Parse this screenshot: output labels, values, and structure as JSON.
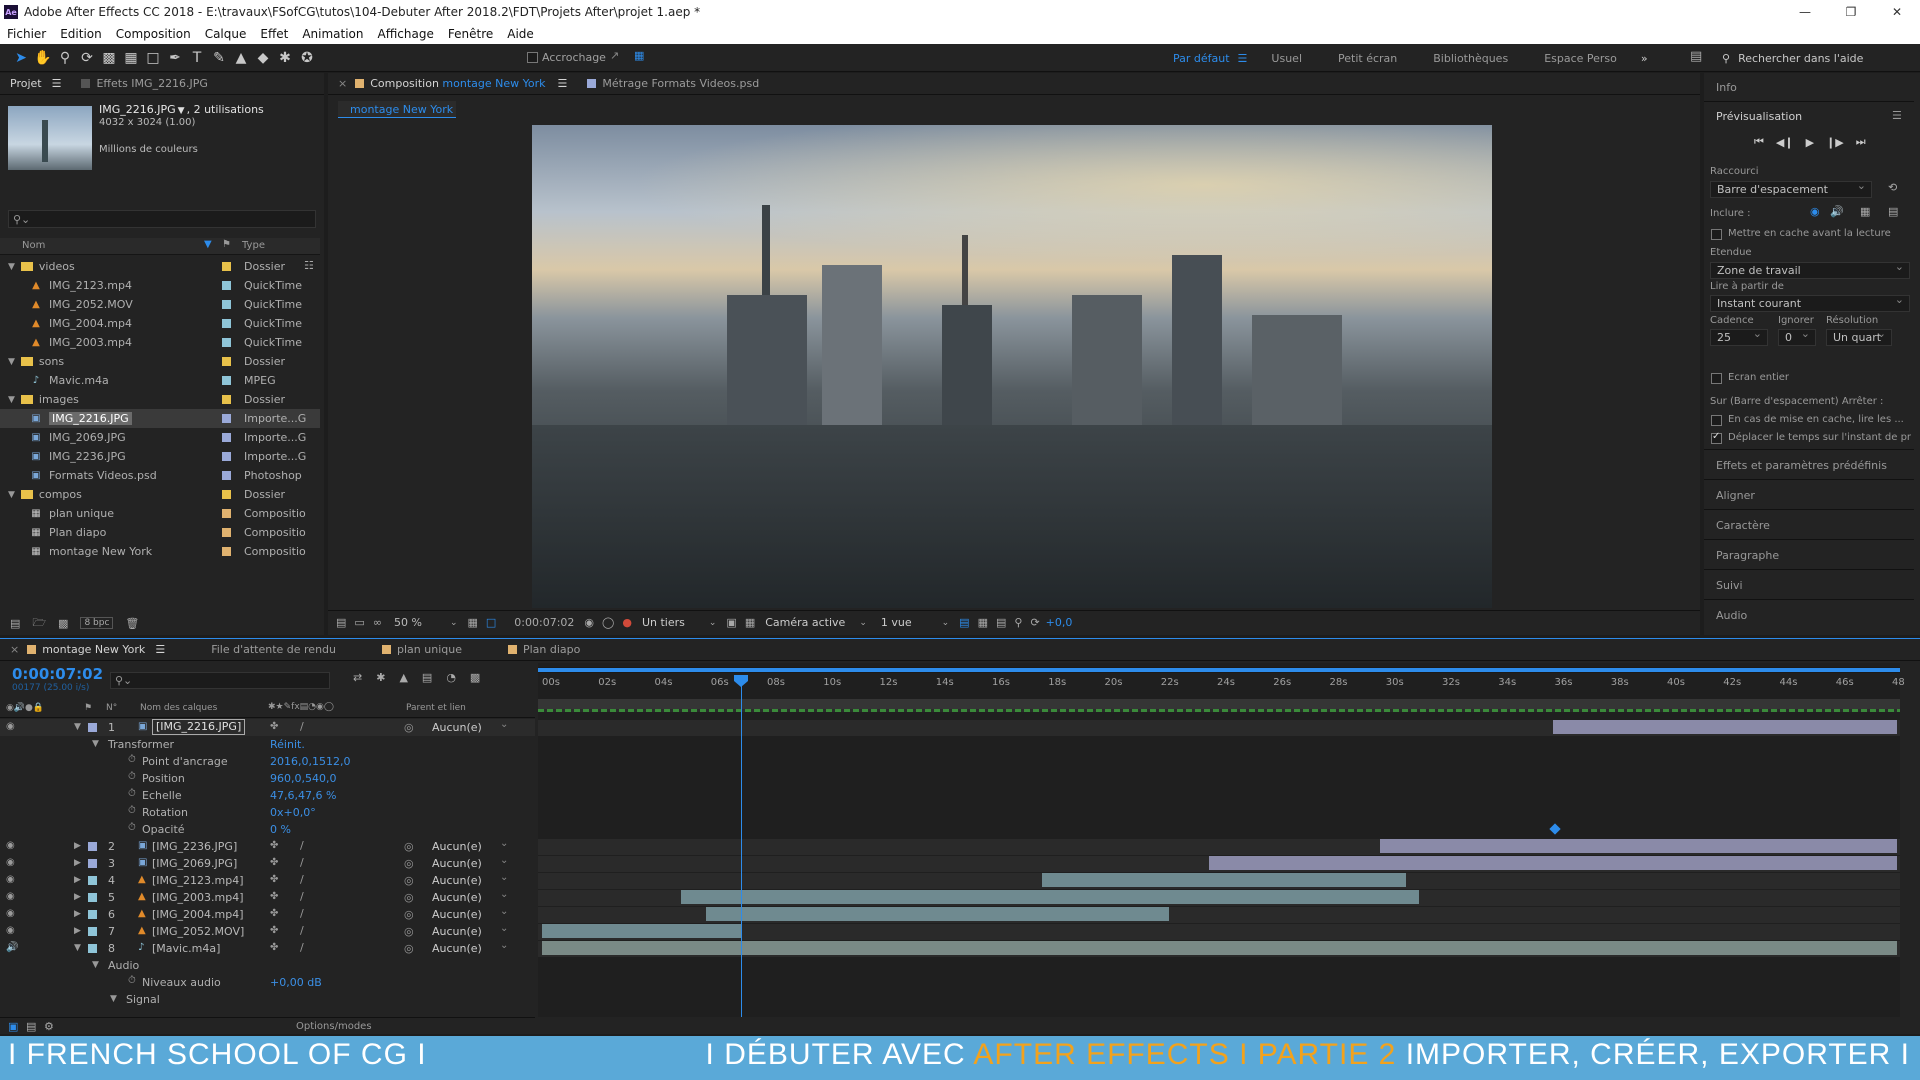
{
  "titlebar": {
    "title": "Adobe After Effects CC 2018 - E:\\travaux\\FSofCG\\tutos\\104-Debuter After 2018.2\\FDT\\Projets After\\projet 1.aep *"
  },
  "menu": [
    "Fichier",
    "Edition",
    "Composition",
    "Calque",
    "Effet",
    "Animation",
    "Affichage",
    "Fenêtre",
    "Aide"
  ],
  "toolbar": {
    "snap_label": "Accrochage",
    "workspaces": [
      "Par défaut",
      "Usuel",
      "Petit écran",
      "Bibliothèques",
      "Espace Perso"
    ],
    "search_placeholder": "Rechercher dans l'aide"
  },
  "project": {
    "tab_project": "Projet",
    "tab_effects": "Effets  IMG_2216.JPG",
    "asset_name": "IMG_2216.JPG",
    "asset_usage": ", 2 utilisations",
    "asset_dims": "4032 x 3024 (1.00)",
    "asset_colors": "Millions de couleurs",
    "col_name": "Nom",
    "col_type": "Type",
    "bpc": "8 bpc",
    "items": [
      {
        "name": "videos",
        "type": "Dossier",
        "kind": "folder",
        "level": 0,
        "color": "#e8c14a"
      },
      {
        "name": "IMG_2123.mp4",
        "type": "QuickTime",
        "kind": "video",
        "level": 1,
        "color": "#8fc5d8"
      },
      {
        "name": "IMG_2052.MOV",
        "type": "QuickTime",
        "kind": "video",
        "level": 1,
        "color": "#8fc5d8"
      },
      {
        "name": "IMG_2004.mp4",
        "type": "QuickTime",
        "kind": "video",
        "level": 1,
        "color": "#8fc5d8"
      },
      {
        "name": "IMG_2003.mp4",
        "type": "QuickTime",
        "kind": "video",
        "level": 1,
        "color": "#8fc5d8"
      },
      {
        "name": "sons",
        "type": "Dossier",
        "kind": "folder",
        "level": 0,
        "color": "#e8c14a"
      },
      {
        "name": "Mavic.m4a",
        "type": "MPEG",
        "kind": "audio",
        "level": 1,
        "color": "#8fc5d8"
      },
      {
        "name": "images",
        "type": "Dossier",
        "kind": "folder",
        "level": 0,
        "color": "#e8c14a"
      },
      {
        "name": "IMG_2216.JPG",
        "type": "Importe...G",
        "kind": "image",
        "level": 1,
        "color": "#9aa9d8",
        "selected": true
      },
      {
        "name": "IMG_2069.JPG",
        "type": "Importe...G",
        "kind": "image",
        "level": 1,
        "color": "#9aa9d8"
      },
      {
        "name": "IMG_2236.JPG",
        "type": "Importe...G",
        "kind": "image",
        "level": 1,
        "color": "#9aa9d8"
      },
      {
        "name": "Formats Videos.psd",
        "type": "Photoshop",
        "kind": "psd",
        "level": 1,
        "color": "#9aa9d8"
      },
      {
        "name": "compos",
        "type": "Dossier",
        "kind": "folder",
        "level": 0,
        "color": "#e8c14a"
      },
      {
        "name": "plan unique",
        "type": "Compositio",
        "kind": "comp",
        "level": 1,
        "color": "#e0b26f"
      },
      {
        "name": "Plan diapo",
        "type": "Compositio",
        "kind": "comp",
        "level": 1,
        "color": "#e0b26f"
      },
      {
        "name": "montage New York",
        "type": "Compositio",
        "kind": "comp",
        "level": 1,
        "color": "#e0b26f"
      }
    ]
  },
  "composition": {
    "tab_prefix": "Composition",
    "tab_name": "montage New York",
    "footage_tab": "Métrage  Formats Videos.psd",
    "subtab": "montage New York",
    "zoom": "50 %",
    "timecode": "0:00:07:02",
    "resolution": "Un tiers",
    "camera": "Caméra active",
    "views": "1 vue",
    "exposure": "+0,0"
  },
  "right_panel": {
    "info": "Info",
    "preview": "Prévisualisation",
    "shortcut_label": "Raccourci",
    "shortcut_value": "Barre d'espacement",
    "include_label": "Inclure :",
    "cache_label": "Mettre en cache avant la lecture",
    "range_label": "Etendue",
    "range_value": "Zone de travail",
    "play_from_label": "Lire à partir de",
    "play_from_value": "Instant courant",
    "fps_label": "Cadence",
    "skip_label": "Ignorer",
    "res_label": "Résolution",
    "fps_value": "25",
    "skip_value": "0",
    "res_value": "Un quart",
    "fullscreen_label": "Ecran entier",
    "on_stop_label": "Sur (Barre d'espacement) Arrêter :",
    "opt1": "En cas de mise en cache, lire les ...",
    "opt2": "Déplacer le temps sur l'instant de pr",
    "sections": [
      "Effets et paramètres prédéfinis",
      "Aligner",
      "Caractère",
      "Paragraphe",
      "Suivi",
      "Audio"
    ]
  },
  "timeline": {
    "tabs": [
      "montage New York",
      "File d'attente de rendu",
      "plan unique",
      "Plan diapo"
    ],
    "timecode": "0:00:07:02",
    "frame_info": "00177 (25.00 i/s)",
    "col_layer": "Nom des calques",
    "col_num": "N°",
    "col_parent": "Parent et lien",
    "transform_label": "Transformer",
    "reset_label": "Réinit.",
    "props": [
      {
        "name": "Point d'ancrage",
        "value": "2016,0,1512,0"
      },
      {
        "name": "Position",
        "value": "960,0,540,0"
      },
      {
        "name": "Echelle",
        "value": "47,6,47,6 %"
      },
      {
        "name": "Rotation",
        "value": "0x+0,0°"
      },
      {
        "name": "Opacité",
        "value": "0 %"
      }
    ],
    "layers": [
      {
        "num": "1",
        "name": "[IMG_2216.JPG]",
        "kind": "image",
        "parent": "Aucun(e)",
        "color": "#9aa9d8",
        "expanded": true,
        "selected": true
      },
      {
        "num": "2",
        "name": "[IMG_2236.JPG]",
        "kind": "image",
        "parent": "Aucun(e)",
        "color": "#9aa9d8"
      },
      {
        "num": "3",
        "name": "[IMG_2069.JPG]",
        "kind": "image",
        "parent": "Aucun(e)",
        "color": "#9aa9d8"
      },
      {
        "num": "4",
        "name": "[IMG_2123.mp4]",
        "kind": "video",
        "parent": "Aucun(e)",
        "color": "#8fc5d8"
      },
      {
        "num": "5",
        "name": "[IMG_2003.mp4]",
        "kind": "video",
        "parent": "Aucun(e)",
        "color": "#8fc5d8"
      },
      {
        "num": "6",
        "name": "[IMG_2004.mp4]",
        "kind": "video",
        "parent": "Aucun(e)",
        "color": "#8fc5d8"
      },
      {
        "num": "7",
        "name": "[IMG_2052.MOV]",
        "kind": "video",
        "parent": "Aucun(e)",
        "color": "#8fc5d8"
      },
      {
        "num": "8",
        "name": "[Mavic.m4a]",
        "kind": "audio",
        "parent": "Aucun(e)",
        "color": "#8fc5d8",
        "expanded": true
      }
    ],
    "audio_label": "Audio",
    "audio_level_label": "Niveaux audio",
    "audio_level_value": "+0,00 dB",
    "signal_label": "Signal",
    "options_label": "Options/modes",
    "ruler": [
      "00s",
      "02s",
      "04s",
      "06s",
      "08s",
      "10s",
      "12s",
      "14s",
      "16s",
      "18s",
      "20s",
      "22s",
      "24s",
      "26s",
      "28s",
      "30s",
      "32s",
      "34s",
      "36s",
      "38s",
      "40s",
      "42s",
      "44s",
      "46s",
      "48"
    ]
  },
  "banner": {
    "left": "I FRENCH SCHOOL OF CG I",
    "right_a": "I DÉBUTER AVEC ",
    "right_b": "AFTER EFFECTS I PARTIE 2",
    "right_c": " IMPORTER, CRÉER, EXPORTER I"
  }
}
